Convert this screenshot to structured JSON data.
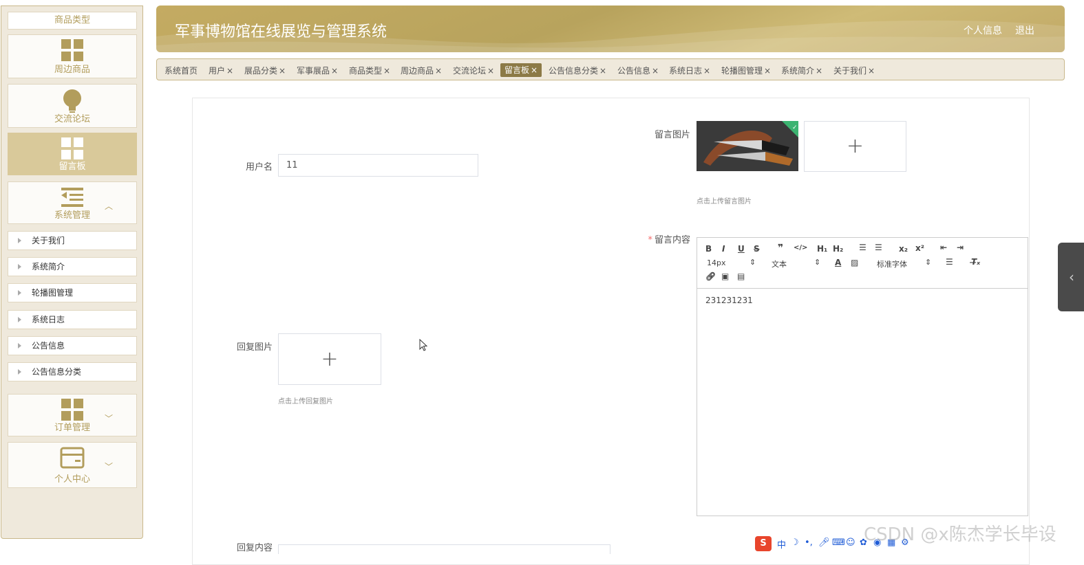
{
  "sidebar": {
    "top_item": "商品类型",
    "blocks": [
      {
        "label": "周边商品",
        "icon": "grid-icon"
      },
      {
        "label": "交流论坛",
        "icon": "bulb-icon"
      },
      {
        "label": "留言板",
        "icon": "grid-icon"
      },
      {
        "label": "系统管理",
        "icon": "menu-indent-icon"
      }
    ],
    "sub_items": [
      "关于我们",
      "系统简介",
      "轮播图管理",
      "系统日志",
      "公告信息",
      "公告信息分类"
    ],
    "bottom_blocks": [
      {
        "label": "订单管理",
        "icon": "grid-icon"
      },
      {
        "label": "个人中心",
        "icon": "wallet-icon"
      }
    ]
  },
  "header": {
    "title": "军事博物馆在线展览与管理系统",
    "links": [
      "个人信息",
      "退出"
    ]
  },
  "tabs": [
    "系统首页",
    "用户",
    "展品分类",
    "军事展品",
    "商品类型",
    "周边商品",
    "交流论坛",
    "留言板",
    "公告信息分类",
    "公告信息",
    "系统日志",
    "轮播图管理",
    "系统简介",
    "关于我们"
  ],
  "tab_close": "×",
  "form": {
    "username_label": "用户名",
    "username_value": "11",
    "message_image_label": "留言图片",
    "message_image_hint": "点击上传留言图片",
    "message_content_label": "留言内容",
    "reply_image_label": "回复图片",
    "reply_image_hint": "点击上传回复图片",
    "reply_content_label": "回复内容",
    "plus": "+"
  },
  "editor": {
    "font_size": "14px",
    "format": "文本",
    "font_family": "标准字体",
    "content": "231231231"
  },
  "watermark": "CSDN @x陈杰学长毕设",
  "colors": {
    "accent": "#b29d5c",
    "active_tab": "#8c7a46",
    "header": "#c4ab62"
  }
}
